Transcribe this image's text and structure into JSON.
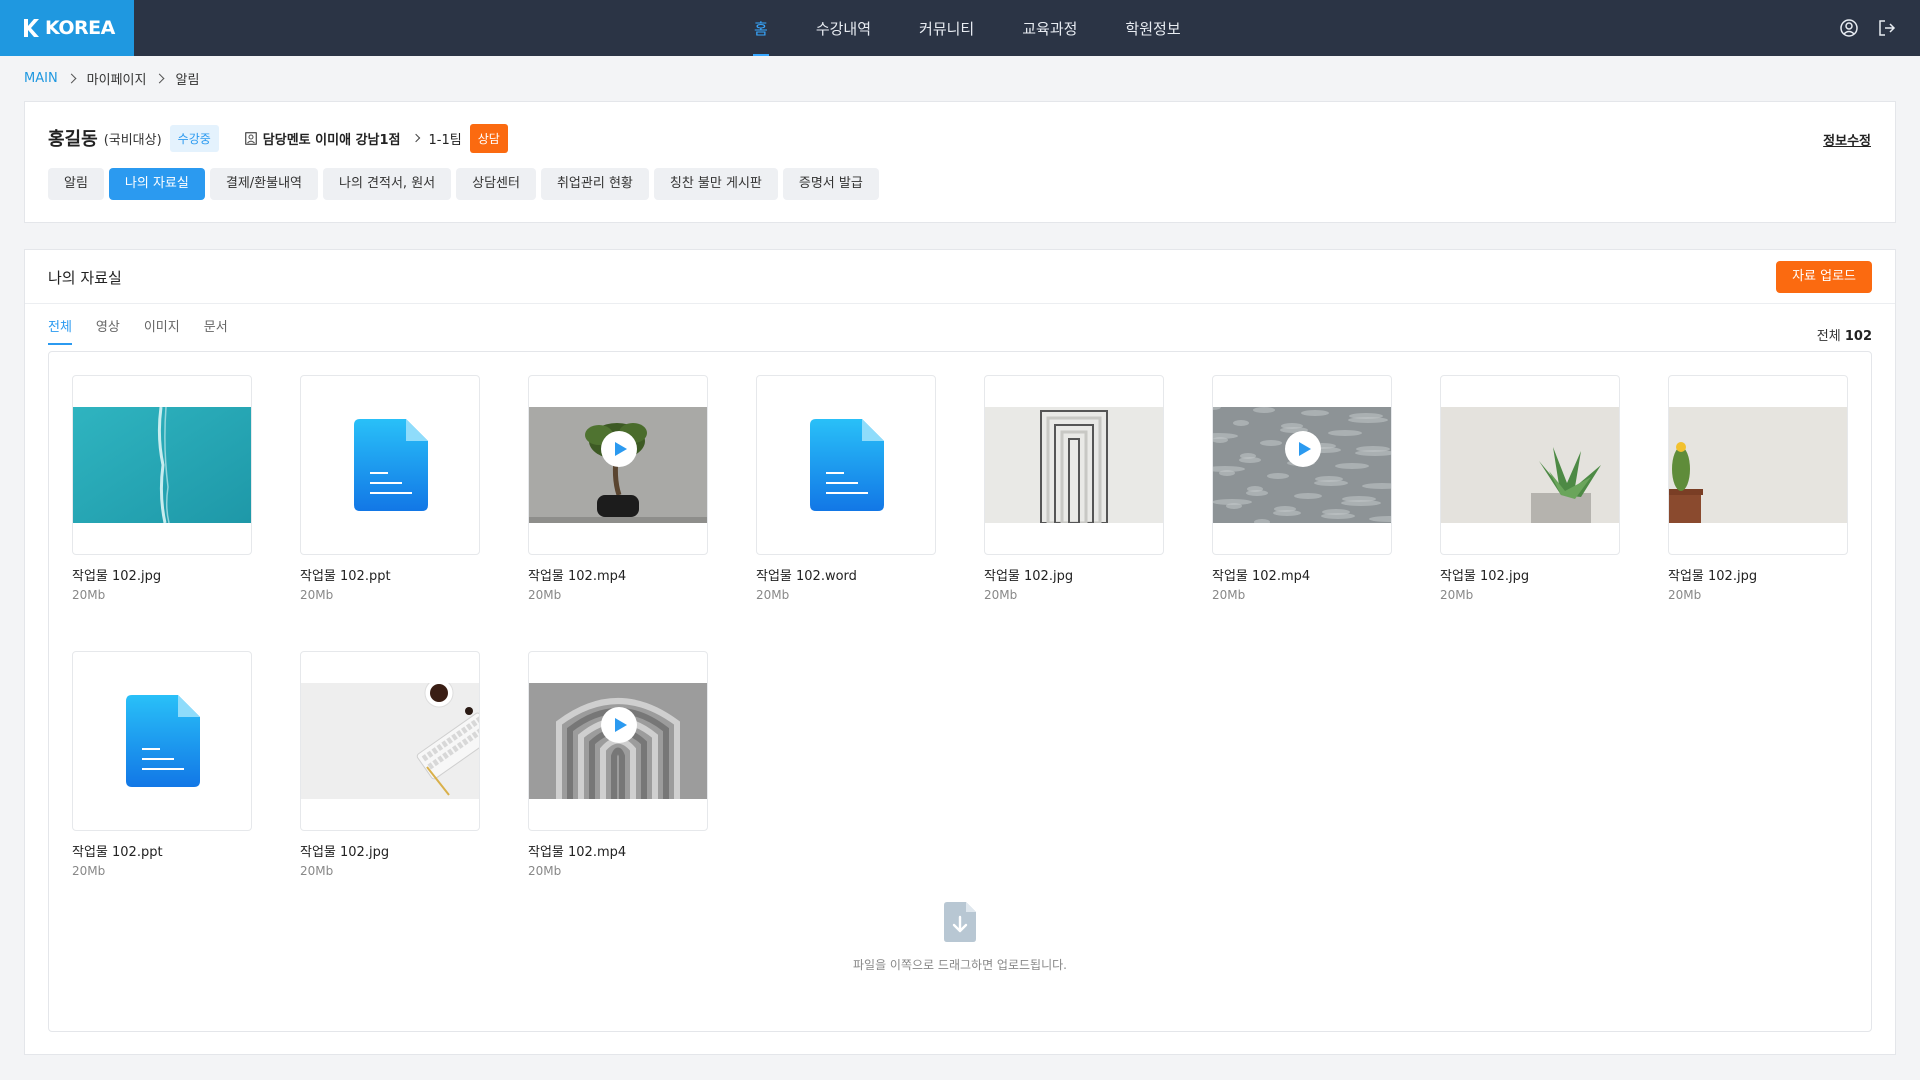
{
  "brand": {
    "name": "KOREA"
  },
  "nav": {
    "items": [
      {
        "label": "홈",
        "active": true
      },
      {
        "label": "수강내역",
        "active": false
      },
      {
        "label": "커뮤니티",
        "active": false
      },
      {
        "label": "교육과정",
        "active": false
      },
      {
        "label": "학원정보",
        "active": false
      }
    ],
    "icons": [
      "user-icon",
      "logout-icon"
    ]
  },
  "breadcrumb": [
    "MAIN",
    "마이페이지",
    "알림"
  ],
  "profile": {
    "name": "홍길동",
    "type": "(국비대상)",
    "status": "수강중",
    "mentor": "담당멘토 이미애 강남1점",
    "team": "1-1팀",
    "consult": "상담",
    "edit": "정보수정",
    "tabs": [
      "알림",
      "나의 자료실",
      "결제/환불내역",
      "나의 견적서, 원서",
      "상담센터",
      "취업관리 현황",
      "칭찬 불만 게시판",
      "증명서 발급"
    ],
    "active_tab": 1
  },
  "library": {
    "title": "나의 자료실",
    "upload_button": "자료 업로드",
    "filters": [
      "전체",
      "영상",
      "이미지",
      "문서"
    ],
    "active_filter": 0,
    "total_label": "전체",
    "total_count": "102",
    "files": [
      {
        "name": "작업물 102.jpg",
        "size": "20Mb",
        "kind": "image",
        "scene": "ocean"
      },
      {
        "name": "작업물 102.ppt",
        "size": "20Mb",
        "kind": "doc"
      },
      {
        "name": "작업물 102.mp4",
        "size": "20Mb",
        "kind": "video",
        "scene": "bonsai"
      },
      {
        "name": "작업물 102.word",
        "size": "20Mb",
        "kind": "doc"
      },
      {
        "name": "작업물 102.jpg",
        "size": "20Mb",
        "kind": "image",
        "scene": "doors"
      },
      {
        "name": "작업물 102.mp4",
        "size": "20Mb",
        "kind": "video",
        "scene": "water"
      },
      {
        "name": "작업물 102.jpg",
        "size": "20Mb",
        "kind": "image",
        "scene": "succulent"
      },
      {
        "name": "작업물 102.jpg",
        "size": "20Mb",
        "kind": "image",
        "scene": "cactus"
      },
      {
        "name": "작업물 102.ppt",
        "size": "20Mb",
        "kind": "doc"
      },
      {
        "name": "작업물 102.jpg",
        "size": "20Mb",
        "kind": "image",
        "scene": "desk"
      },
      {
        "name": "작업물 102.mp4",
        "size": "20Mb",
        "kind": "video",
        "scene": "arches"
      }
    ],
    "drop_text": "파일을 이쪽으로 드래그하면 업로드됩니다."
  },
  "colors": {
    "nav_bg": "#2b3445",
    "brand": "#1f98e0",
    "accent": "#2b9af0",
    "orange": "#fb6a10"
  }
}
